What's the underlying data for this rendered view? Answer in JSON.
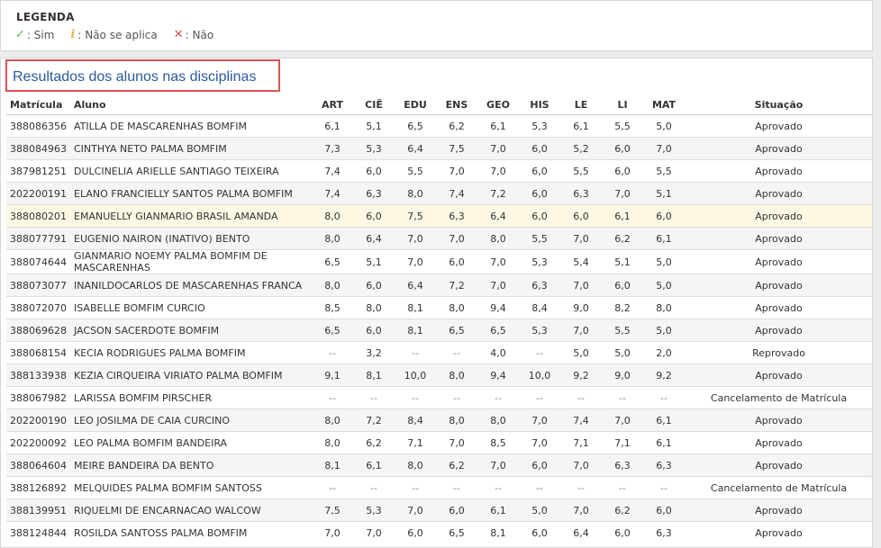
{
  "legend": {
    "title": "LEGENDA",
    "items": [
      {
        "icon": "check-icon",
        "symbol": "✓",
        "label": ": Sim",
        "color": "#5cb85c"
      },
      {
        "icon": "info-icon",
        "symbol": "i",
        "label": ": Não se aplica",
        "color": "#f0ad4e"
      },
      {
        "icon": "x-icon",
        "symbol": "✕",
        "label": ": Não",
        "color": "#d9534f"
      }
    ]
  },
  "results": {
    "title": "Resultados dos alunos nas disciplinas",
    "columns": [
      "Matrícula",
      "Aluno",
      "ART",
      "CIÊ",
      "EDU",
      "ENS",
      "GEO",
      "HIS",
      "LE",
      "LI",
      "MAT",
      "Situação"
    ],
    "rows": [
      [
        "388086356",
        "ATILLA DE MASCARENHAS BOMFIM",
        "6,1",
        "5,1",
        "6,5",
        "6,2",
        "6,1",
        "5,3",
        "6,1",
        "5,5",
        "5,0",
        "Aprovado"
      ],
      [
        "388084963",
        "CINTHYA NETO PALMA BOMFIM",
        "7,3",
        "5,3",
        "6,4",
        "7,5",
        "7,0",
        "6,0",
        "5,2",
        "6,0",
        "7,0",
        "Aprovado"
      ],
      [
        "387981251",
        "DULCINELIA ARIELLE SANTIAGO TEIXEIRA",
        "7,4",
        "6,0",
        "5,5",
        "7,0",
        "7,0",
        "6,0",
        "5,5",
        "6,0",
        "5,5",
        "Aprovado"
      ],
      [
        "202200191",
        "ELANO FRANCIELLY SANTOS PALMA BOMFIM",
        "7,4",
        "6,3",
        "8,0",
        "7,4",
        "7,2",
        "6,0",
        "6,3",
        "7,0",
        "5,1",
        "Aprovado"
      ],
      [
        "388080201",
        "EMANUELLY GIANMARIO BRASIL AMANDA",
        "8,0",
        "6,0",
        "7,5",
        "6,3",
        "6,4",
        "6,0",
        "6,0",
        "6,1",
        "6,0",
        "Aprovado"
      ],
      [
        "388077791",
        "EUGENIO NAIRON (INATIVO) BENTO",
        "8,0",
        "6,4",
        "7,0",
        "7,0",
        "8,0",
        "5,5",
        "7,0",
        "6,2",
        "6,1",
        "Aprovado"
      ],
      [
        "388074644",
        "GIANMARIO NOEMY PALMA BOMFIM DE MASCARENHAS",
        "6,5",
        "5,1",
        "7,0",
        "6,0",
        "7,0",
        "5,3",
        "5,4",
        "5,1",
        "5,0",
        "Aprovado"
      ],
      [
        "388073077",
        "INANILDOCARLOS DE MASCARENHAS FRANCA",
        "8,0",
        "6,0",
        "6,4",
        "7,2",
        "7,0",
        "6,3",
        "7,0",
        "6,0",
        "5,0",
        "Aprovado"
      ],
      [
        "388072070",
        "ISABELLE BOMFIM CURCIO",
        "8,5",
        "8,0",
        "8,1",
        "8,0",
        "9,4",
        "8,4",
        "9,0",
        "8,2",
        "8,0",
        "Aprovado"
      ],
      [
        "388069628",
        "JACSON SACERDOTE BOMFIM",
        "6,5",
        "6,0",
        "8,1",
        "6,5",
        "6,5",
        "5,3",
        "7,0",
        "5,5",
        "5,0",
        "Aprovado"
      ],
      [
        "388068154",
        "KECIA RODRIGUES PALMA BOMFIM",
        "--",
        "3,2",
        "--",
        "--",
        "4,0",
        "--",
        "5,0",
        "5,0",
        "2,0",
        "Reprovado"
      ],
      [
        "388133938",
        "KEZIA CIRQUEIRA VIRIATO PALMA BOMFIM",
        "9,1",
        "8,1",
        "10,0",
        "8,0",
        "9,4",
        "10,0",
        "9,2",
        "9,0",
        "9,2",
        "Aprovado"
      ],
      [
        "388067982",
        "LARISSA BOMFIM PIRSCHER",
        "--",
        "--",
        "--",
        "--",
        "--",
        "--",
        "--",
        "--",
        "--",
        "Cancelamento de Matrícula"
      ],
      [
        "202200190",
        "LEO JOSILMA DE CAIA CURCINO",
        "8,0",
        "7,2",
        "8,4",
        "8,0",
        "8,0",
        "7,0",
        "7,4",
        "7,0",
        "6,1",
        "Aprovado"
      ],
      [
        "202200092",
        "LEO PALMA BOMFIM BANDEIRA",
        "8,0",
        "6,2",
        "7,1",
        "7,0",
        "8,5",
        "7,0",
        "7,1",
        "7,1",
        "6,1",
        "Aprovado"
      ],
      [
        "388064604",
        "MEIRE BANDEIRA DA BENTO",
        "8,1",
        "6,1",
        "8,0",
        "6,2",
        "7,0",
        "6,0",
        "7,0",
        "6,3",
        "6,3",
        "Aprovado"
      ],
      [
        "388126892",
        "MELQUIDES PALMA BOMFIM SANTOSS",
        "--",
        "--",
        "--",
        "--",
        "--",
        "--",
        "--",
        "--",
        "--",
        "Cancelamento de Matrícula"
      ],
      [
        "388139951",
        "RIQUELMI DE ENCARNACAO WALCOW",
        "7,5",
        "5,3",
        "7,0",
        "6,0",
        "6,1",
        "5,0",
        "7,0",
        "6,2",
        "6,0",
        "Aprovado"
      ],
      [
        "388124844",
        "ROSILDA SANTOSS PALMA BOMFIM",
        "7,0",
        "7,0",
        "6,0",
        "6,5",
        "8,1",
        "6,0",
        "6,4",
        "6,0",
        "6,3",
        "Aprovado"
      ]
    ],
    "highlight_row": 4
  }
}
